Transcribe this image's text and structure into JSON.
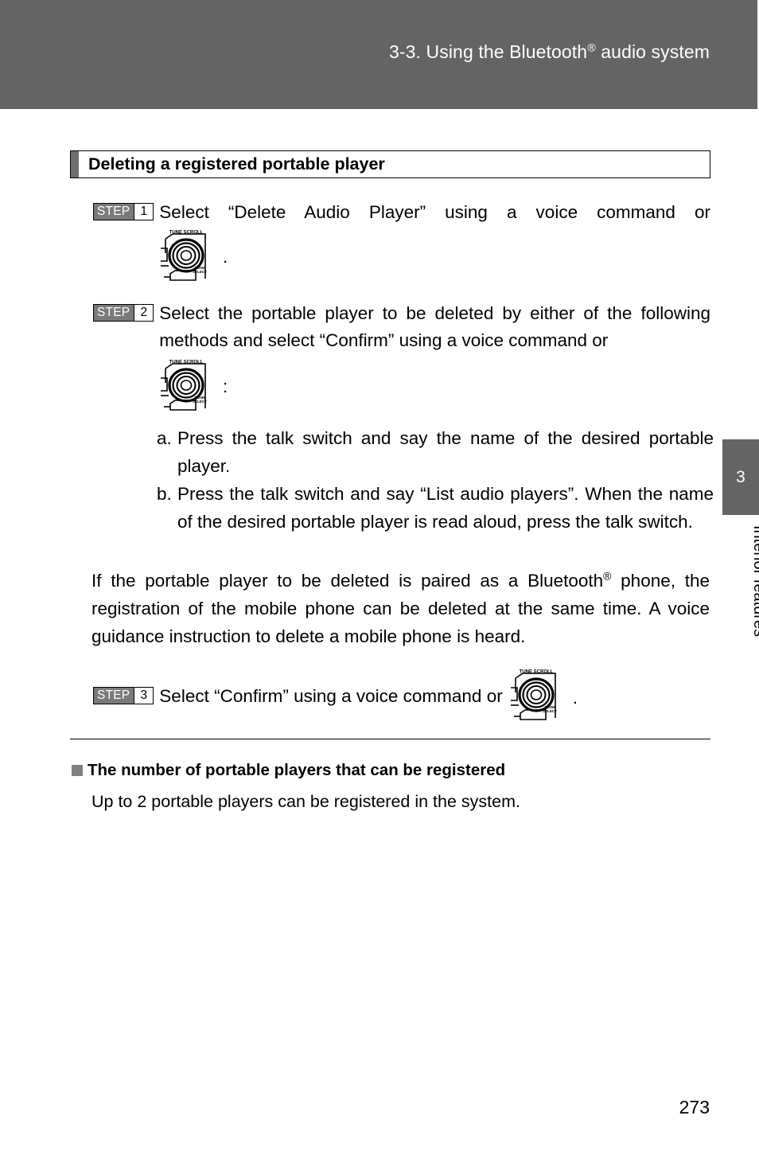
{
  "header": {
    "title_prefix": "3-3. Using the Bluetooth",
    "title_sup": "®",
    "title_suffix": " audio system",
    "band_color": "#646464"
  },
  "section": {
    "heading": "Deleting a registered portable player",
    "accent_color": "#6e6e6e"
  },
  "steps": [
    {
      "badge_word": "STEP",
      "badge_num": "1",
      "text": "Select “Delete Audio Player” using a voice command or",
      "knob_icon": "tune-scroll-knob-icon",
      "after_knob": "."
    },
    {
      "badge_word": "STEP",
      "badge_num": "2",
      "text": "Select the portable player to be deleted by either of the following methods and select “Confirm” using a voice command or",
      "knob_icon": "tune-scroll-knob-icon",
      "after_knob": ":"
    },
    {
      "badge_word": "STEP",
      "badge_num": "3",
      "text": "Select “Confirm” using a voice command or",
      "knob_icon": "tune-scroll-knob-icon",
      "after_knob": "."
    }
  ],
  "sub_list": [
    {
      "marker": "a.",
      "text": "Press the talk switch and say the name of the desired portable player."
    },
    {
      "marker": "b.",
      "text": "Press the talk switch and say “List audio players”. When the name of the desired portable player is read aloud, press the talk switch."
    }
  ],
  "paragraph": {
    "part1": "If the portable player to be deleted is paired as a Bluetooth",
    "sup": "®",
    "part2": " phone, the registration of the mobile phone can be deleted at the same time. A voice guidance instruction to delete a mobile phone is heard."
  },
  "note": {
    "heading": "The number of portable players that can be registered",
    "body": "Up to 2 portable players can be registered in the system.",
    "bullet_color": "#808080"
  },
  "knob_labels": {
    "top": "TUNE SCROLL",
    "bottom_line1": "PUSH",
    "bottom_line2": "SELECT"
  },
  "side_tab": {
    "number": "3",
    "label": "Interior features",
    "color": "#646464"
  },
  "page_number": "273"
}
